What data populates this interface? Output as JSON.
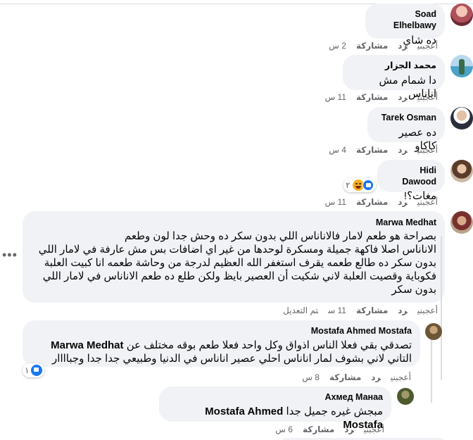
{
  "actions": {
    "like": "أعجبني",
    "reply": "رد",
    "share": "مشاركة",
    "edited": "تم التعديل"
  },
  "colors": {
    "bubble": "#f0f2f5",
    "like_blue": "#1877f2",
    "haha_yellow": "#f7b125",
    "meta_gray": "#65676b"
  },
  "comments": [
    {
      "author": "Soad Elhelbawy",
      "text": "ده شاي",
      "time": "2 س"
    },
    {
      "author": "محمد الجزار",
      "text": "دا شمام مش اناناس",
      "time": "11 س"
    },
    {
      "author": "Tarek Osman",
      "text": "ده عصير كاكاو",
      "time": "4 س"
    },
    {
      "author": "Hidi Dawood",
      "text": "مغات؟!",
      "time": "11 س",
      "reaction_count": "٢",
      "reaction_icons": [
        "like-icon",
        "haha-icon"
      ]
    },
    {
      "author": "Marwa Medhat",
      "lines": [
        "بصراحة هو طعم لامار فالاناناس اللي بدون سكر ده وحش جدا لون وطعم",
        "الاناناس اصلا فاكهة جميلة ومسكرة لوحدها من غير اي اضافات بس مش عارفة في لامار اللي",
        "بدون سكر ده طالع طعمه يقرف استغفر الله العظيم لدرجة من وحاشة طعمه انا كبيت العلبة",
        "فكوباية وقصيت العلبة لاني شكيت أن العصير بايظ ولكن طلع ده طعم الاناناس في لامار اللي",
        "بدون سكر"
      ],
      "time": "11 س",
      "edited": true
    },
    {
      "author": "Mostafa Ahmed Mostafa",
      "mention": "Marwa Medhat",
      "line1_text": "تصدقي بقي فعلا الناس اذواق وكل واحد فعلا طعم بوقه مختلف عن",
      "line2_text": "التاني لاني بشوف لمار اناناس احلي عصير اناناس في الدنيا وطبيعي جدا جدا وجباااار",
      "time": "8 س",
      "reaction_count": "١",
      "reaction_icons": [
        "like-icon"
      ]
    },
    {
      "author": "Ахмед Манаа",
      "mention": "Mostafa Ahmed Mostafa",
      "text": "مبجش غيره جميل جدا",
      "time": "6 س"
    }
  ]
}
